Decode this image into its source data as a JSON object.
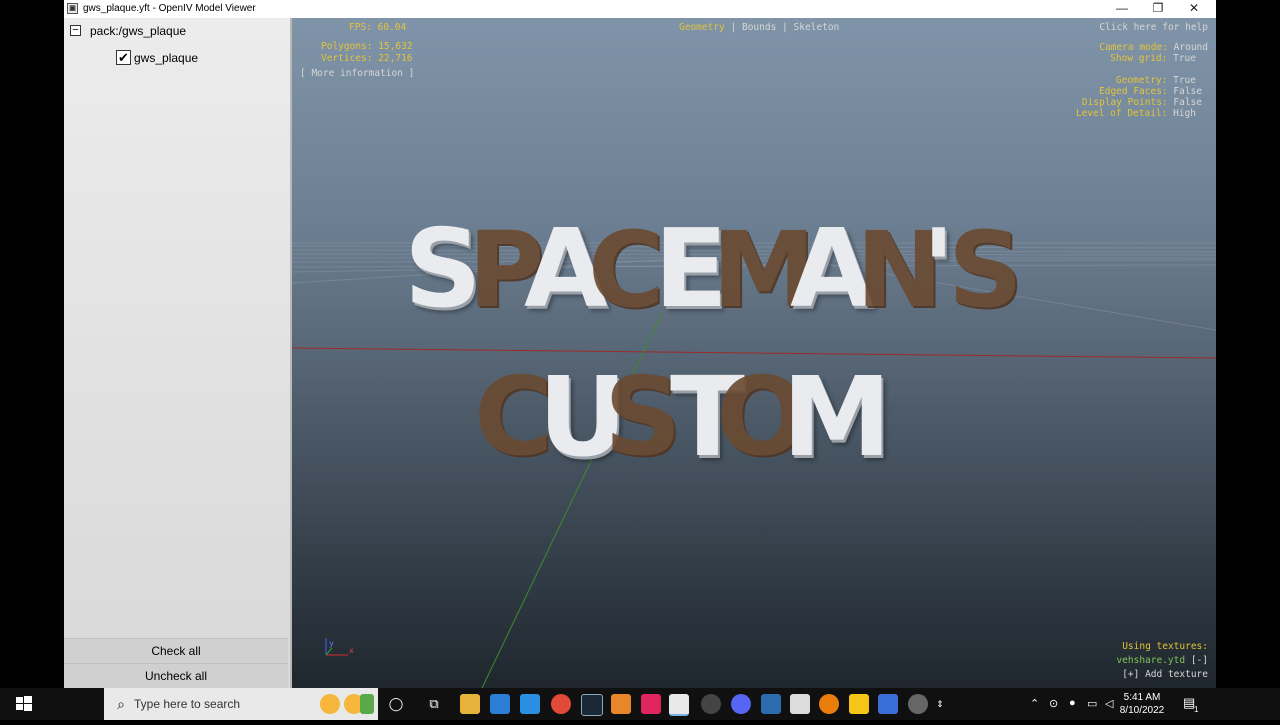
{
  "window": {
    "title": "gws_plaque.yft - OpenIV Model Viewer",
    "minimize_glyph": "—",
    "maximize_glyph": "❐",
    "close_glyph": "✕"
  },
  "sidebar": {
    "root_label": "pack:/gws_plaque",
    "expander_glyph": "−",
    "child_label": "gws_plaque",
    "child_checked": true,
    "check_glyph": "✔",
    "check_all_label": "Check all",
    "uncheck_all_label": "Uncheck all"
  },
  "viewport": {
    "stats": {
      "fps": "FPS: 60.04",
      "polygons": "Polygons: 15,632",
      "vertices": "Vertices: 22,716",
      "more_info": "[ More information ]"
    },
    "modes": {
      "geometry": "Geometry",
      "bounds": "Bounds",
      "skeleton": "Skeleton",
      "separator": "|"
    },
    "help_text": "Click here for help",
    "settings": {
      "camera_mode_label": "Camera mode:",
      "camera_mode_value": "Around",
      "show_grid_label": "Show grid:",
      "show_grid_value": "True",
      "geometry_label": "Geometry:",
      "geometry_value": "True",
      "edged_faces_label": "Edged Faces:",
      "edged_faces_value": "False",
      "display_points_label": "Display Points:",
      "display_points_value": "False",
      "lod_label": "Level of Detail:",
      "lod_value": "High"
    },
    "textures": {
      "header": "Using textures:",
      "texture_file": "vehshare.ytd",
      "remove_label": "[-]",
      "add_label": "[+] Add texture"
    },
    "model_text": {
      "line1": [
        "S",
        "P",
        "A",
        "C",
        "E",
        "M",
        "A",
        "N",
        "'",
        "S"
      ],
      "line2": [
        "C",
        "U",
        "S",
        "T",
        "O",
        "M"
      ]
    },
    "axis_labels": {
      "y": "y",
      "x": "x"
    }
  },
  "taskbar": {
    "search_placeholder": "Type here to search",
    "time": "5:41 AM",
    "date": "8/10/2022",
    "notification_count": "1"
  },
  "colors": {
    "overlay_yellow": "#e3c33a",
    "overlay_white": "#d6d6d6",
    "texture_green": "#7fc35a",
    "model_white": "#e9ebee",
    "model_brown": "#6a4a31"
  }
}
